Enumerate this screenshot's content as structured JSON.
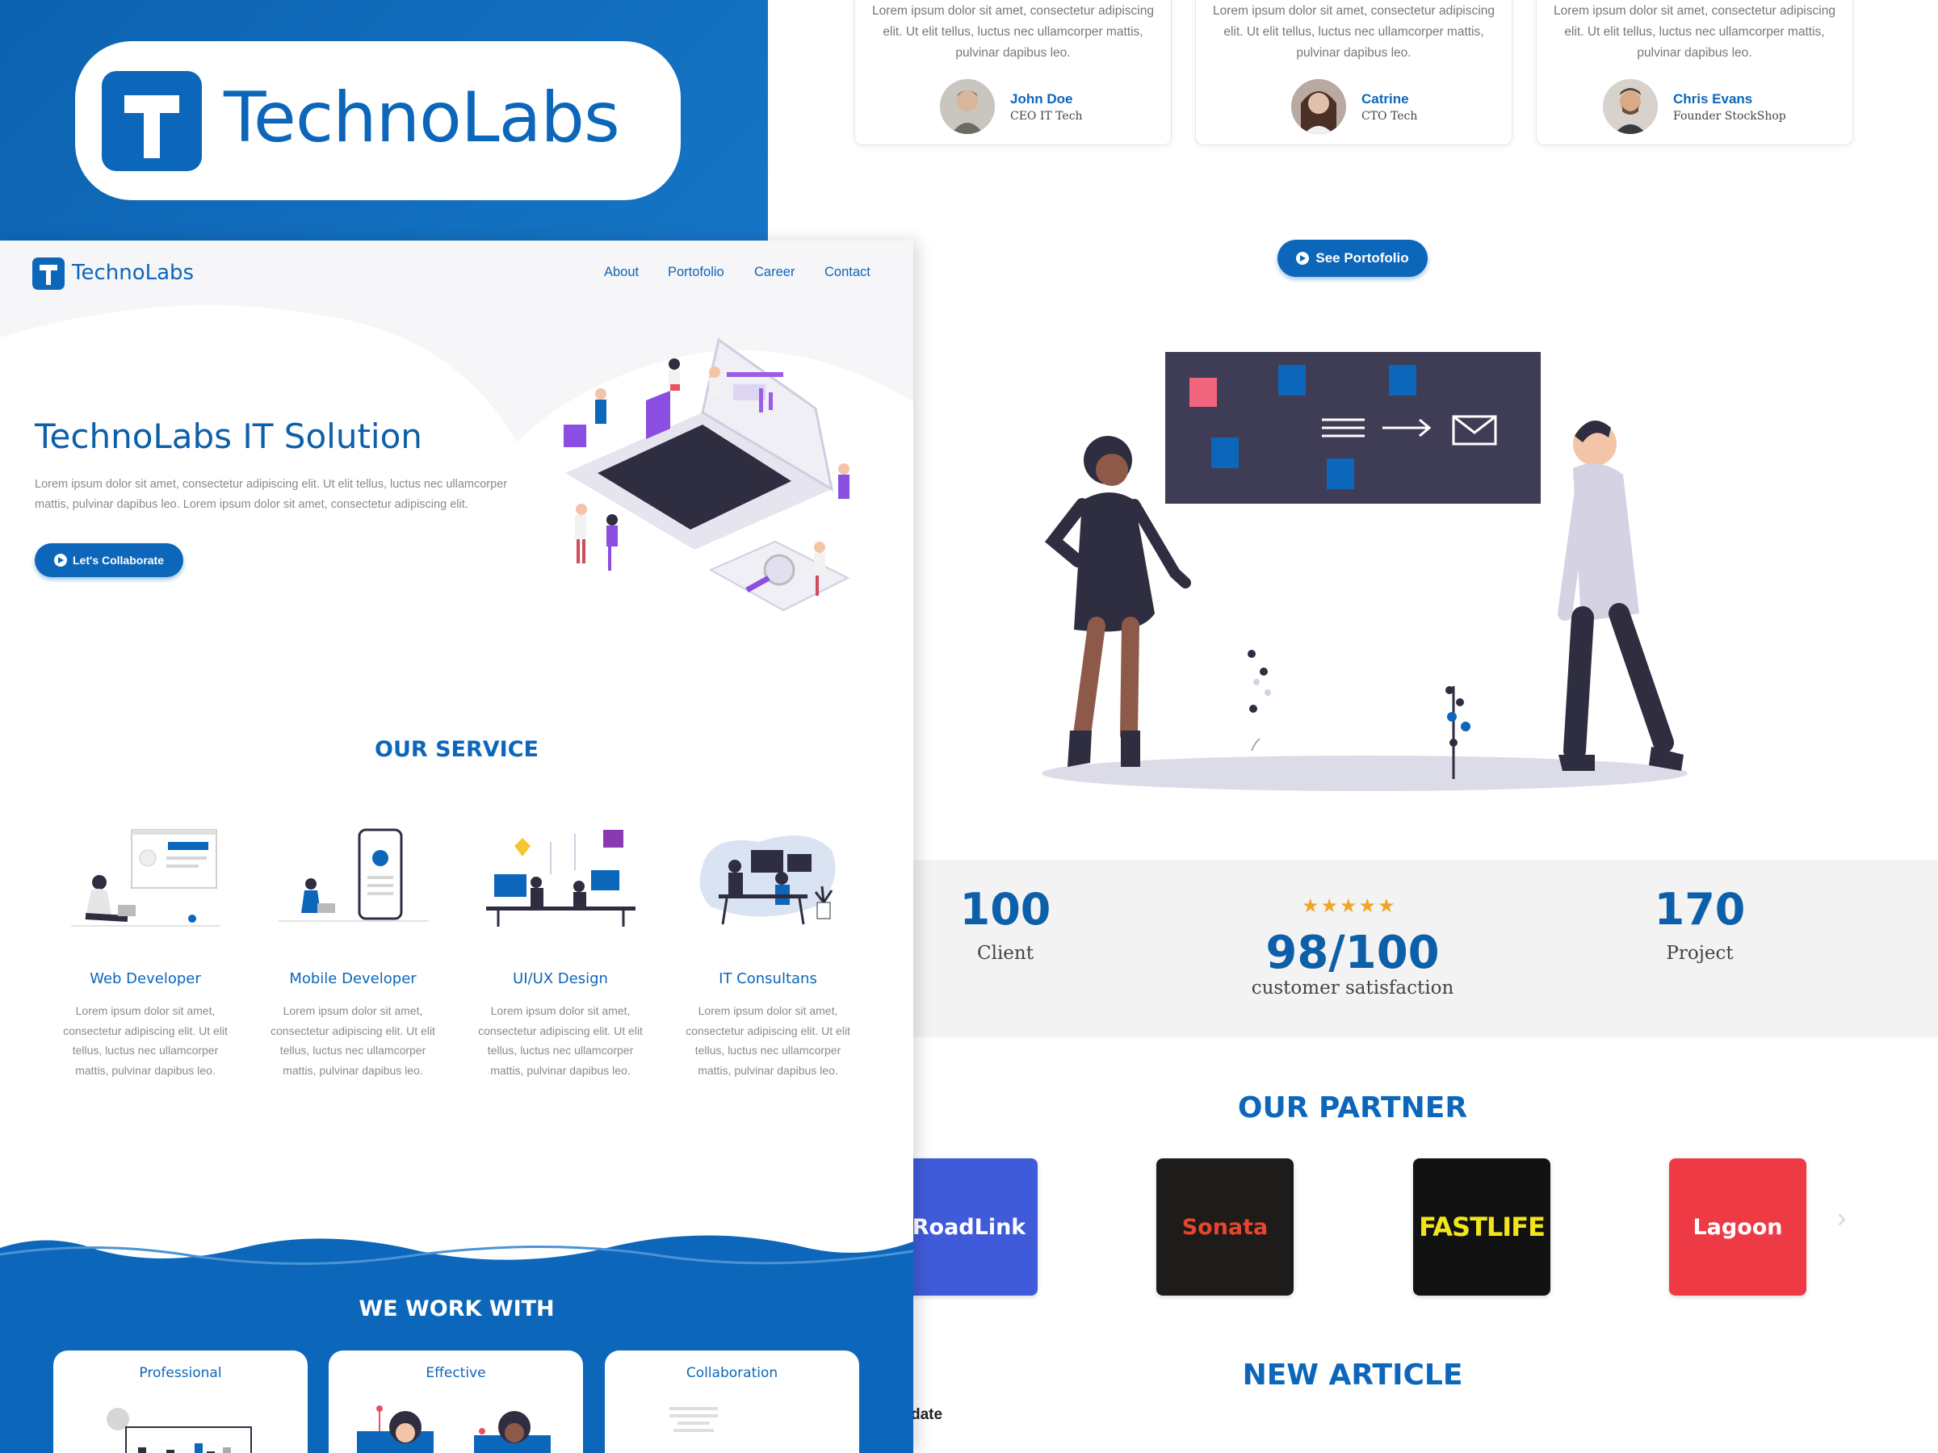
{
  "brand": {
    "name": "TechnoLabs",
    "logo_letter": "T"
  },
  "testimonials": [
    {
      "quote": "Lorem ipsum dolor sit amet, consectetur adipiscing elit. Ut elit tellus, luctus nec ullamcorper mattis, pulvinar dapibus leo.",
      "name": "John Doe",
      "role": "CEO IT Tech"
    },
    {
      "quote": "Lorem ipsum dolor sit amet, consectetur adipiscing elit. Ut elit tellus, luctus nec ullamcorper mattis, pulvinar dapibus leo.",
      "name": "Catrine",
      "role": "CTO Tech"
    },
    {
      "quote": "Lorem ipsum dolor sit amet, consectetur adipiscing elit. Ut elit tellus, luctus nec ullamcorper mattis, pulvinar dapibus leo.",
      "name": "Chris Evans",
      "role": "Founder StockShop"
    }
  ],
  "portfolio_button": {
    "label": "See Portofolio"
  },
  "stats": {
    "client": {
      "value": "100",
      "label": "Client"
    },
    "satisfaction": {
      "value": "98/100",
      "label": "customer satisfaction",
      "rating": 5
    },
    "project": {
      "value": "170",
      "label": "Project"
    }
  },
  "partners": {
    "title": "OUR PARTNER",
    "items": [
      {
        "name": "RoadLink",
        "bg": "#3f5bd9",
        "fg": "#ffffff"
      },
      {
        "name": "Sonata",
        "bg": "#1e1b1b",
        "fg": "#e8452b"
      },
      {
        "name": "FASTLIFE",
        "bg": "#121212",
        "fg": "#f2e51a"
      },
      {
        "name": "Lagoon",
        "bg": "#ee3a45",
        "fg": "#ffffff"
      }
    ]
  },
  "articles": {
    "title": "NEW ARTICLE",
    "date_label": "date"
  },
  "left_page": {
    "logo_text": "TechnoLabs",
    "nav": [
      "About",
      "Portofolio",
      "Career",
      "Contact"
    ],
    "hero": {
      "title": "TechnoLabs IT Solution",
      "description": "Lorem ipsum dolor sit amet, consectetur adipiscing elit. Ut elit tellus, luctus nec ullamcorper mattis, pulvinar dapibus leo. Lorem ipsum dolor sit amet, consectetur adipiscing elit.",
      "cta": "Let's Collaborate"
    },
    "services": {
      "title": "OUR SERVICE",
      "items": [
        {
          "name": "Web Developer",
          "desc": "Lorem ipsum dolor sit amet, consectetur adipiscing elit. Ut elit tellus, luctus nec ullamcorper mattis, pulvinar dapibus leo."
        },
        {
          "name": "Mobile Developer",
          "desc": "Lorem ipsum dolor sit amet, consectetur adipiscing elit. Ut elit tellus, luctus nec ullamcorper mattis, pulvinar dapibus leo."
        },
        {
          "name": "UI/UX Design",
          "desc": "Lorem ipsum dolor sit amet, consectetur adipiscing elit. Ut elit tellus, luctus nec ullamcorper mattis, pulvinar dapibus leo."
        },
        {
          "name": "IT Consultans",
          "desc": "Lorem ipsum dolor sit amet, consectetur adipiscing elit. Ut elit tellus, luctus nec ullamcorper mattis, pulvinar dapibus leo."
        }
      ]
    },
    "work_with": {
      "title": "WE WORK WITH",
      "items": [
        "Professional",
        "Effective",
        "Collaboration"
      ]
    }
  },
  "colors": {
    "primary": "#0c66ba",
    "star": "#f1a526",
    "stats_bg": "#f3f3f3"
  }
}
